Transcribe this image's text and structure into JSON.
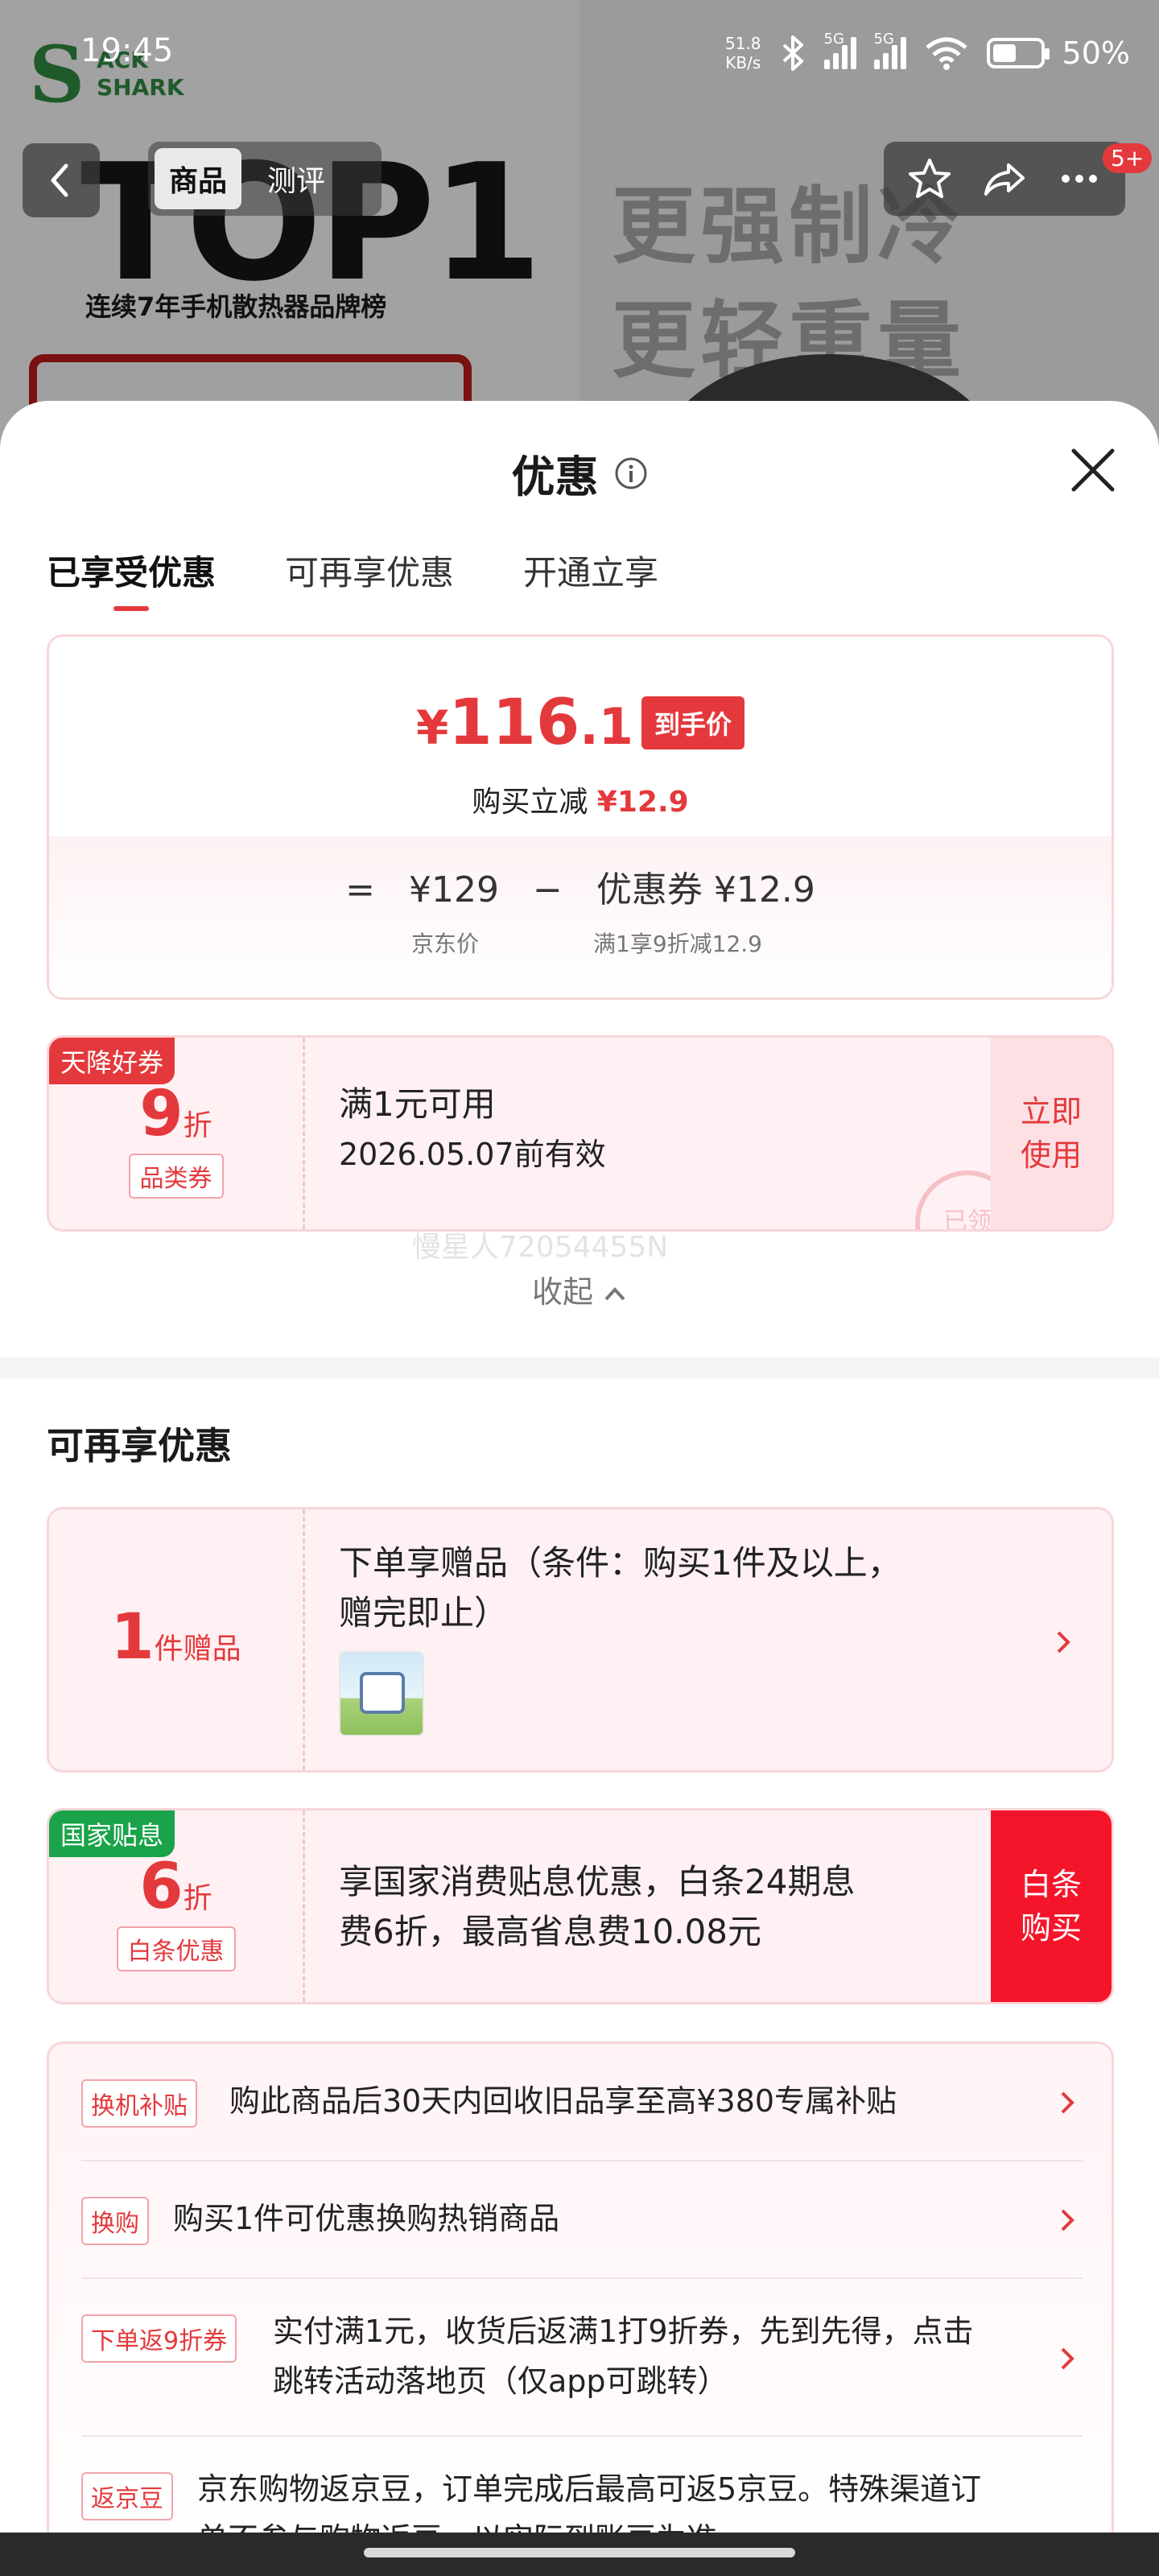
{
  "status_bar": {
    "time": "19:45",
    "net_speed_value": "51.8",
    "net_speed_unit": "KB/s",
    "signal_1_tag": "5G",
    "signal_2_tag": "5G",
    "battery_percent": "50%",
    "battery_level": 0.5
  },
  "background": {
    "brand_logo_line1": "ACK",
    "brand_logo_line2": "SHARK",
    "hero_title": "TOP1",
    "hero_subtitle": "连续7年手机散热器品牌榜",
    "slogan_line1": "更强制冷",
    "slogan_line2": "更轻重量",
    "nav_tabs": [
      "商品",
      "测评"
    ],
    "cart_badge": "5+",
    "icons": [
      "back-icon",
      "star-icon",
      "share-icon",
      "more-icon"
    ]
  },
  "sheet": {
    "title": "优惠",
    "tabs": [
      "已享受优惠",
      "可再享优惠",
      "开通立享"
    ],
    "price": {
      "currency": "¥",
      "integer": "116",
      "decimal": ".1",
      "tag": "到手价",
      "save_label": "购买立减",
      "save_amount": "¥12.9",
      "eq": "=",
      "orig_price": "¥129",
      "minus": "−",
      "coupon_price": "优惠券 ¥12.9",
      "orig_label": "京东价",
      "coupon_label": "满1享9折减12.9"
    },
    "coupon1": {
      "corner": "天降好券",
      "num": "9",
      "unit": "折",
      "type": "品类券",
      "line1": "满1元可用",
      "line2": "2026.05.07前有效",
      "action_line1": "立即",
      "action_line2": "使用",
      "stamp": "已领"
    },
    "watermark": "慢星人72054455N",
    "collapse": "收起",
    "section_title": "可再享优惠",
    "gift": {
      "num": "1",
      "unit": "件赠品",
      "line1": "下单享赠品（条件：购买1件及以上，",
      "line2": "赠完即止）"
    },
    "national": {
      "corner": "国家贴息",
      "num": "6",
      "unit": "折",
      "type": "白条优惠",
      "line1": "享国家消费贴息优惠，白条24期息",
      "line2": "费6折，最高省息费10.08元",
      "action_line1": "白条",
      "action_line2": "购买"
    },
    "list": [
      {
        "tag": "换机补贴",
        "line1": "购此商品后30天内回收旧品享至高¥380专属补贴",
        "line2": ""
      },
      {
        "tag": "换购",
        "line1": "购买1件可优惠换购热销商品",
        "line2": ""
      },
      {
        "tag": "下单返9折券",
        "line1": "实付满1元，收货后返满1打9折券，先到先得，点击",
        "line2": "跳转活动落地页（仅app可跳转）"
      },
      {
        "tag": "返京豆",
        "line1": "京东购物返京豆，订单完成后最高可返5京豆。特殊渠道订",
        "line2": "单不参与购物返豆，以实际到账豆为准"
      }
    ]
  },
  "colors": {
    "accent_red": "#e4393c",
    "tag_green": "#1aa34a",
    "card_pink": "#fff1f3"
  }
}
